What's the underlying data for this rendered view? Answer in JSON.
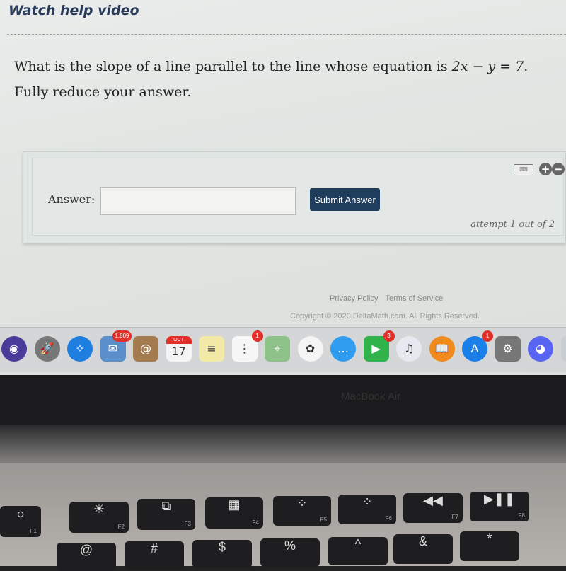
{
  "header": {
    "help_link": "Watch help video"
  },
  "question": {
    "text_before": "What is the slope of a line parallel to the line whose equation is ",
    "equation": "2x − y = 7",
    "text_after": ". Fully reduce your answer."
  },
  "answer": {
    "label": "Answer:",
    "value": "",
    "placeholder": "",
    "submit_label": "Submit Answer",
    "attempt": "attempt 1 out of 2",
    "keyboard_icon": "keyboard-icon",
    "zoom_in": "+",
    "zoom_out": "−"
  },
  "footer": {
    "privacy": "Privacy Policy",
    "terms": "Terms of Service",
    "copyright": "Copyright © 2020 DeltaMath.com. All Rights Reserved."
  },
  "dock": {
    "apps": [
      {
        "name": "siri",
        "color": "#4a3a9a",
        "glyph": "◉"
      },
      {
        "name": "launchpad",
        "color": "#777",
        "glyph": "🚀"
      },
      {
        "name": "safari",
        "color": "#1e7fe0",
        "glyph": "✧"
      },
      {
        "name": "mail",
        "color": "#5a8fcc",
        "glyph": "✉",
        "badge": "1,809"
      },
      {
        "name": "contacts",
        "color": "#a37b4f",
        "glyph": "@"
      },
      {
        "name": "calendar",
        "color": "#f4f4f4",
        "glyph": "17",
        "month": "OCT"
      },
      {
        "name": "notes",
        "color": "#f3e9a8",
        "glyph": "≡"
      },
      {
        "name": "reminders",
        "color": "#f6f6f6",
        "glyph": "⋮",
        "badge": "1"
      },
      {
        "name": "maps",
        "color": "#8fc18a",
        "glyph": "⌖"
      },
      {
        "name": "photos",
        "color": "#f5f5f5",
        "glyph": "✿"
      },
      {
        "name": "messages",
        "color": "#2f9cf0",
        "glyph": "…"
      },
      {
        "name": "facetime",
        "color": "#2fb34a",
        "glyph": "▶",
        "badge": "3"
      },
      {
        "name": "itunes",
        "color": "#e8e8f0",
        "glyph": "♫"
      },
      {
        "name": "books",
        "color": "#f08a1c",
        "glyph": "📖"
      },
      {
        "name": "app-store",
        "color": "#1a7fe8",
        "glyph": "A",
        "badge": "1"
      },
      {
        "name": "system-preferences",
        "color": "#777",
        "glyph": "⚙"
      },
      {
        "name": "discord",
        "color": "#5865f2",
        "glyph": "◕"
      },
      {
        "name": "finder",
        "color": "#c8cdd2",
        "glyph": ""
      }
    ]
  },
  "laptop": {
    "model": "MacBook Air"
  },
  "keys": {
    "f1": "F1",
    "f2": "F2",
    "f3": "F3",
    "f4": "F4",
    "f5": "F5",
    "f6": "F6",
    "f7": "F7",
    "f8": "F8",
    "at": "@",
    "hash": "#",
    "dollar": "$",
    "percent": "%",
    "caret": "^",
    "amp": "&",
    "star": "*"
  }
}
